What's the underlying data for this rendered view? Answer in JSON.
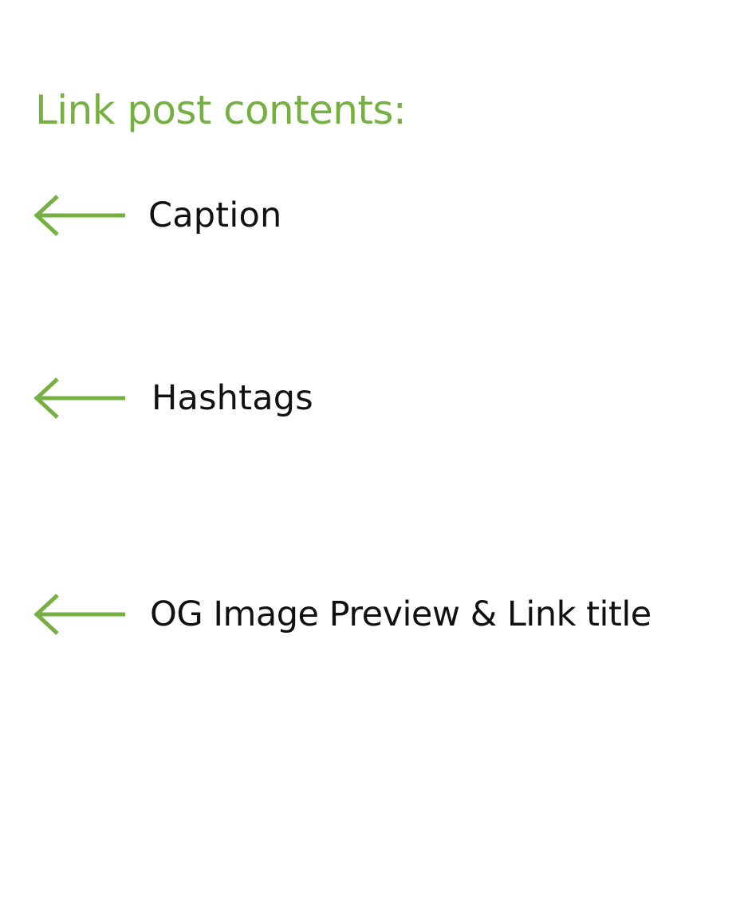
{
  "title": "Link post contents:",
  "items": [
    {
      "label": "Caption",
      "icon": "arrow-left-icon"
    },
    {
      "label": "Hashtags",
      "icon": "arrow-left-icon"
    },
    {
      "label": "OG Image Preview & Link title",
      "icon": "arrow-left-icon"
    }
  ],
  "colors": {
    "accent": "#76b043",
    "text": "#111111",
    "background": "#ffffff"
  }
}
